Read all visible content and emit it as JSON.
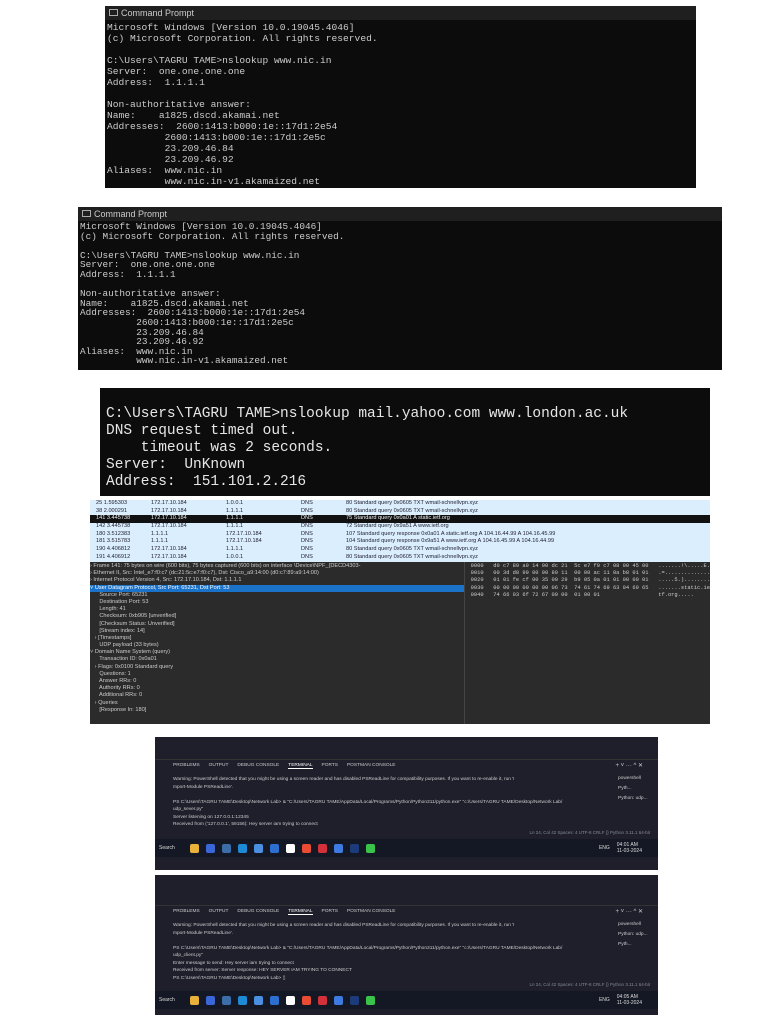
{
  "cmd1": {
    "title": "Command Prompt",
    "lines": [
      "Microsoft Windows [Version 10.0.19045.4046]",
      "(c) Microsoft Corporation. All rights reserved.",
      "",
      "C:\\Users\\TAGRU TAME>nslookup www.nic.in",
      "Server:  one.one.one.one",
      "Address:  1.1.1.1",
      "",
      "Non-authoritative answer:",
      "Name:    a1825.dscd.akamai.net",
      "Addresses:  2600:1413:b000:1e::17d1:2e54",
      "          2600:1413:b000:1e::17d1:2e5c",
      "          23.209.46.84",
      "          23.209.46.92",
      "Aliases:  www.nic.in",
      "          www.nic.in-v1.akamaized.net"
    ]
  },
  "cmd2": {
    "title": "Command Prompt",
    "lines": [
      "Microsoft Windows [Version 10.0.19045.4046]",
      "(c) Microsoft Corporation. All rights reserved.",
      "",
      "C:\\Users\\TAGRU TAME>nslookup www.nic.in",
      "Server:  one.one.one.one",
      "Address:  1.1.1.1",
      "",
      "Non-authoritative answer:",
      "Name:    a1825.dscd.akamai.net",
      "Addresses:  2600:1413:b000:1e::17d1:2e54",
      "          2600:1413:b000:1e::17d1:2e5c",
      "          23.209.46.84",
      "          23.209.46.92",
      "Aliases:  www.nic.in",
      "          www.nic.in-v1.akamaized.net"
    ]
  },
  "cmd3": {
    "lines": [
      "C:\\Users\\TAGRU TAME>nslookup mail.yahoo.com www.london.ac.uk",
      "DNS request timed out.",
      "    timeout was 2 seconds.",
      "Server:  UnKnown",
      "Address:  151.101.2.216"
    ]
  },
  "wireshark": {
    "packets": [
      [
        "25 1.595303",
        "172.17.10.184",
        "1.0.0.1",
        "DNS",
        "80 Standard query 0x0605 TXT wmail-schnellvpn.xyz"
      ],
      [
        "38 2.000291",
        "172.17.10.184",
        "1.1.1.1",
        "DNS",
        "80 Standard query 0x0605 TXT wmail-schnellvpn.xyz"
      ],
      [
        "141 3.445738",
        "172.17.10.184",
        "1.1.1.1",
        "DNS",
        "75 Standard query 0x0a01 A static.ietf.org"
      ],
      [
        "142 3.445738",
        "172.17.10.184",
        "1.1.1.1",
        "DNS",
        "72 Standard query 0x9a51 A www.ietf.org"
      ],
      [
        "180 3.512383",
        "1.1.1.1",
        "172.17.10.184",
        "DNS",
        "107 Standard query response 0x0a01 A static.ietf.org A 104.16.44.99 A 104.16.45.99"
      ],
      [
        "181 3.515783",
        "1.1.1.1",
        "172.17.10.184",
        "DNS",
        "104 Standard query response 0x9a51 A www.ietf.org A 104.16.45.99 A 104.16.44.99"
      ],
      [
        "190 4.406812",
        "172.17.10.184",
        "1.1.1.1",
        "DNS",
        "80 Standard query 0x0605 TXT wmail-schnellvpn.xyz"
      ],
      [
        "191 4.406912",
        "172.17.10.184",
        "1.0.0.1",
        "DNS",
        "80 Standard query 0x0605 TXT wmail-schnellvpn.xyz"
      ]
    ],
    "details": [
      "› Frame 141: 75 bytes on wire (600 bits), 75 bytes captured (600 bits) on interface \\Device\\NPF_{DECD4303-",
      "› Ethernet II, Src: Intel_e7:f0:c7 (dc:21:5c:e7:f0:c7), Dst: Cisco_a9:14:00 (d0:c7:89:a9:14:00)",
      "› Internet Protocol Version 4, Src: 172.17.10.184, Dst: 1.1.1.1",
      "˅ User Datagram Protocol, Src Port: 65231, Dst Port: 53",
      "      Source Port: 65231",
      "      Destination Port: 53",
      "      Length: 41",
      "      Checksum: 0xb905 [unverified]",
      "      [Checksum Status: Unverified]",
      "      [Stream index: 14]",
      "   › [Timestamps]",
      "      UDP payload (33 bytes)",
      "˅ Domain Name System (query)",
      "      Transaction ID: 0x0a01",
      "   › Flags: 0x0100 Standard query",
      "      Questions: 1",
      "      Answer RRs: 0",
      "      Authority RRs: 0",
      "      Additional RRs: 0",
      "   › Queries",
      "      [Response In: 180]"
    ],
    "hex": [
      "0000   d0 c7 89 a9 14 00 dc 21  5c e7 f0 c7 08 00 45 00   .......!\\.....E.",
      "0010   00 3d d8 99 00 00 80 11  00 00 ac 11 0a b8 01 01   .=..............",
      "0020   01 01 fe cf 00 35 00 29  b9 05 0a 01 01 00 00 01   .....5.)........",
      "0030   00 00 00 00 00 00 06 73  74 61 74 69 63 04 69 65   .......static.ie",
      "0040   74 66 03 6f 72 67 00 00  01 00 01                  tf.org....."
    ]
  },
  "vscode": {
    "tabs": [
      "PROBLEMS",
      "OUTPUT",
      "DEBUG CONSOLE",
      "TERMINAL",
      "PORTS",
      "POSTMAN CONSOLE"
    ],
    "status": "Ln 24, Col 42   Spaces: 4   UTF-8   CRLF   {} Python   3.11.1 64-bit",
    "search": "Search",
    "lang": "ENG",
    "s1": {
      "terms": [
        "powershell",
        "Pyth...",
        "Python: udp..."
      ],
      "lines": [
        "Warning: PowerShell detected that you might be using a screen reader and has disabled PSReadLine for compatibility purposes. If you want to re-enable it, run 'I",
        "mport-Module PSReadLine'.",
        "",
        "PS C:\\Users\\TAGRU TAME\\Desktop\\Network Lab> & \"C:/Users/TAGRU TAME/AppData/Local/Programs/Python/Python311/python.exe\" \"c:/Users/TAGRU TAME/Desktop/Network Lab/",
        "udp_sever.py\"",
        "Server listening on 127.0.0.1:12345",
        "Received from ('127.0.0.1', 59156): Hey server iam trying to connect"
      ],
      "time": "04:01 AM",
      "date": "11-03-2024"
    },
    "s2": {
      "terms": [
        "powershell",
        "Python: udp...",
        "Pyth..."
      ],
      "lines": [
        "Warning: PowerShell detected that you might be using a screen reader and has disabled PSReadLine for compatibility purposes. If you want to re-enable it, run 'I",
        "mport-Module PSReadLine'.",
        "",
        "PS C:\\Users\\TAGRU TAME\\Desktop\\Network Lab> & \"C:/Users/TAGRU TAME/AppData/Local/Programs/Python/Python311/python.exe\" \"c:/Users/TAGRU TAME/Desktop/Network Lab/",
        "udp_client.py\"",
        "Enter message to send: Hey server iam trying to connect",
        "Received from server: Server response: HEY SERVER IAM TRYING TO CONNECT",
        "PS C:\\Users\\TAGRU TAME\\Desktop\\Network Lab> ▯"
      ],
      "time": "04:05 AM",
      "date": "11-03-2024"
    },
    "taskbar_colors": [
      "#e8b23a",
      "#3a66d8",
      "#3b6ea8",
      "#1e8ad6",
      "#4a8fe0",
      "#2d6fd0",
      "#fff",
      "#e94b35",
      "#d4303a",
      "#3d7be0",
      "#1b3b7a",
      "#3ac34a"
    ]
  }
}
